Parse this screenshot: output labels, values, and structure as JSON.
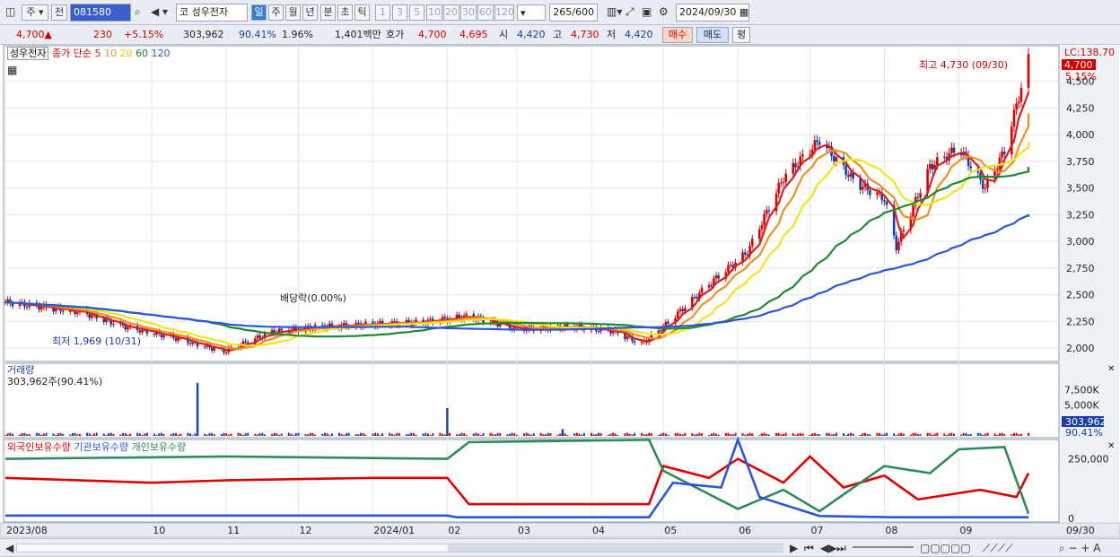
{
  "toolbar": {
    "market_btn": "주",
    "prev_btn": "전",
    "code": "081580",
    "name_prefix": "코",
    "stock_name": "성우전자",
    "periods": [
      "일",
      "주",
      "월",
      "년",
      "분",
      "초",
      "틱"
    ],
    "intervals": [
      "1",
      "3",
      "5",
      "10",
      "20",
      "30",
      "60",
      "120"
    ],
    "count": "265",
    "count_max": "/600",
    "date": "2024/09/30"
  },
  "quote": {
    "price": "4,700",
    "up_mark": "▲",
    "change": "230",
    "pct": "+5.15%",
    "volume": "303,962",
    "vol_ratio": "90.41%",
    "turnover": "1.96%",
    "amount": "1,401백만",
    "ask_label": "호가",
    "ask": "4,700",
    "bid": "4,695",
    "open_label": "시",
    "open": "4,420",
    "high_label": "고",
    "high": "4,730",
    "low_label": "저",
    "low": "4,420",
    "buy": "매수",
    "sell": "매도",
    "eval": "평"
  },
  "price_panel": {
    "name": "성우전자",
    "legend_label": "종가 단순",
    "ma_labels": [
      "5",
      "10",
      "20",
      "60",
      "120"
    ],
    "lc": "LC:138.70",
    "last_price": "4,700",
    "last_pct": "5.15%",
    "high_note": "최고 4,730 (09/30)",
    "low_note": "최저 1,969 (10/31)",
    "dividend_note": "배당락(0.00%)",
    "y_ticks": [
      "4,500",
      "4,250",
      "4,000",
      "3,750",
      "3,500",
      "3,250",
      "3,000",
      "2,750",
      "2,500",
      "2,250",
      "2,000"
    ]
  },
  "volume_panel": {
    "title": "거래량",
    "info": "303,962주(90.41%)",
    "y_ticks": [
      "7,500K",
      "5,000K"
    ],
    "last_value": "303,962",
    "last_pct": "90.41%"
  },
  "holding_panel": {
    "series_labels": [
      "외국인보유수량",
      "기관보유수량",
      "개인보유수량"
    ],
    "y_ticks": [
      "250,000",
      "0"
    ]
  },
  "x_axis": {
    "labels": [
      "2023/08",
      "10",
      "11",
      "12",
      "2024/01",
      "02",
      "03",
      "04",
      "05",
      "06",
      "07",
      "08",
      "09"
    ],
    "end_label": "09/30"
  },
  "colors": {
    "up": "#e00000",
    "down": "#1a3ea8",
    "ma5": "#d42020",
    "ma10": "#f0901c",
    "ma20": "#f2e41a",
    "ma60": "#1e8a2e",
    "ma120": "#2a56d8",
    "foreign": "#e00000",
    "institution": "#2a56d8",
    "individual": "#2e8b57"
  },
  "chart_data": {
    "type": "candlestick",
    "x_range": [
      "2023/08",
      "2024/09/30"
    ],
    "ylim": [
      1900,
      4800
    ],
    "close_path": [
      [
        "2023-08-01",
        2430
      ],
      [
        "2023-09-01",
        2340
      ],
      [
        "2023-09-20",
        2200
      ],
      [
        "2023-10-10",
        2100
      ],
      [
        "2023-10-31",
        1969
      ],
      [
        "2023-11-20",
        2150
      ],
      [
        "2023-12-10",
        2200
      ],
      [
        "2024-01-05",
        2230
      ],
      [
        "2024-01-20",
        2240
      ],
      [
        "2024-02-10",
        2300
      ],
      [
        "2024-03-01",
        2180
      ],
      [
        "2024-03-25",
        2200
      ],
      [
        "2024-04-10",
        2160
      ],
      [
        "2024-04-22",
        2040
      ],
      [
        "2024-05-01",
        2200
      ],
      [
        "2024-05-20",
        2600
      ],
      [
        "2024-06-05",
        2900
      ],
      [
        "2024-06-20",
        3600
      ],
      [
        "2024-07-05",
        3950
      ],
      [
        "2024-07-20",
        3550
      ],
      [
        "2024-08-01",
        3400
      ],
      [
        "2024-08-06",
        2950
      ],
      [
        "2024-08-20",
        3700
      ],
      [
        "2024-09-01",
        3880
      ],
      [
        "2024-09-12",
        3500
      ],
      [
        "2024-09-20",
        3850
      ],
      [
        "2024-09-30",
        4700
      ]
    ],
    "ma_end_values": {
      "ma5": 4400,
      "ma10": 4200,
      "ma20": 3930,
      "ma60": 3700,
      "ma120": 3230
    },
    "volume_spikes": [
      [
        "2023-10-20",
        8600000
      ],
      [
        "2024-02-01",
        4500000
      ],
      [
        "2024-03-20",
        1100000
      ]
    ]
  }
}
